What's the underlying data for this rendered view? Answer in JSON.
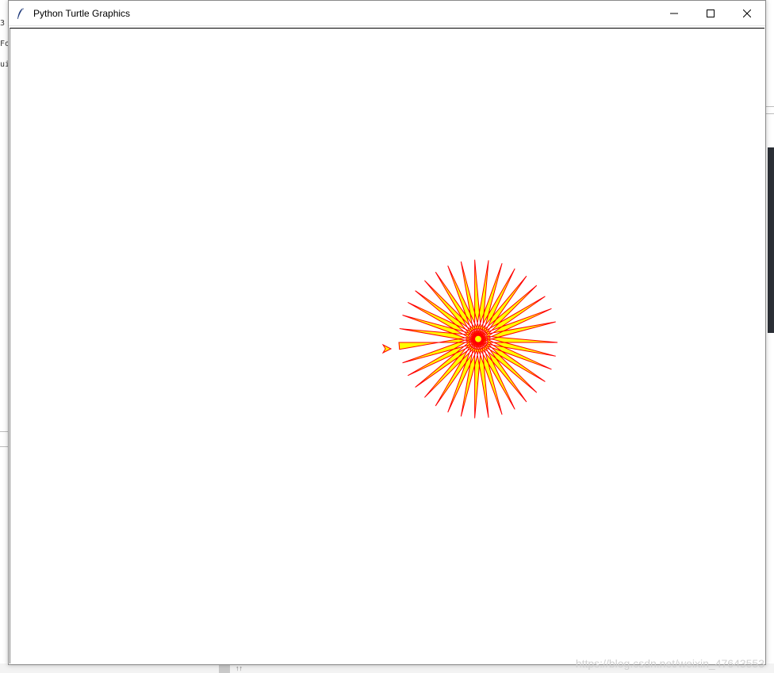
{
  "window": {
    "title": "Python Turtle Graphics",
    "controls": {
      "minimize_icon": "minimize-icon",
      "maximize_icon": "maximize-icon",
      "close_icon": "close-icon"
    }
  },
  "background": {
    "left_fragments": [
      "3",
      "Fo",
      "ui"
    ],
    "bottom_fragment": "↑↑"
  },
  "drawing": {
    "shape": "star",
    "points": 36,
    "fill_color": "#ffff00",
    "pen_color": "#ff0000",
    "turtle_color": "#ff0000",
    "turtle_fill": "#ffff00",
    "turtle_shape": "arrow"
  },
  "watermark": "https://blog.csdn.net/weixin_47643553"
}
